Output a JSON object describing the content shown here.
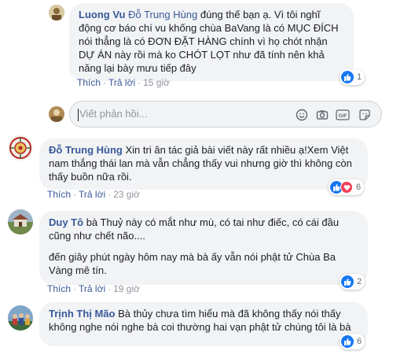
{
  "reply_thread": {
    "author": "Luong Vu",
    "tag": "Đỗ Trung Hùng",
    "text": " đúng thế bạn ạ. Vì tôi nghĩ động cơ báo chí vu khống chùa BaVang là có MỤC ĐÍCH nói thẳng là có ĐƠN ĐẶT HÀNG chính vì họ chót nhận DỰ ÁN này rồi mà ko CHÓT LỌT như đã tính nên khả năng lại bày mưu tiếp đây",
    "like": "Thích",
    "reply": "Trả lời",
    "time": "15 giờ",
    "reaction_count": "1"
  },
  "reply_input": {
    "placeholder": "Viết phản hồi..."
  },
  "comments": [
    {
      "author": "Đỗ Trung Hùng",
      "text": "Xin tri ân tác giả bài viết này rất nhiều ạ!Xem Việt nam thắng thái lan mà vẫn chẳng thấy vui nhưng giờ thì không còn thấy buồn nữa rồi.",
      "like": "Thích",
      "reply": "Trả lời",
      "time": "23 giờ",
      "reaction_count": "6"
    },
    {
      "author": "Duy Tô",
      "text": "bà Thuỷ này có mắt như mù, có tai như điếc, có cái đầu cũng như chết não....",
      "text2": "đến giây phút ngày hôm nay mà bà ấy vẫn nói phật tử Chùa Ba Vàng mê tín.",
      "like": "Thích",
      "reply": "Trả lời",
      "time": "19 giờ",
      "reaction_count": "2"
    },
    {
      "author": "Trịnh Thị Mão",
      "text": "Bà thủy chưa tìm hiểu mà đã không thấy nói thấy không nghe nói nghe bà coi thường hai vạn phật tử chúng tôi là bà",
      "reaction_count": "6"
    }
  ],
  "colors": {
    "link": "#385898",
    "bubble": "#f2f3f5",
    "like": "#1877f2",
    "love": "#f33e58"
  }
}
